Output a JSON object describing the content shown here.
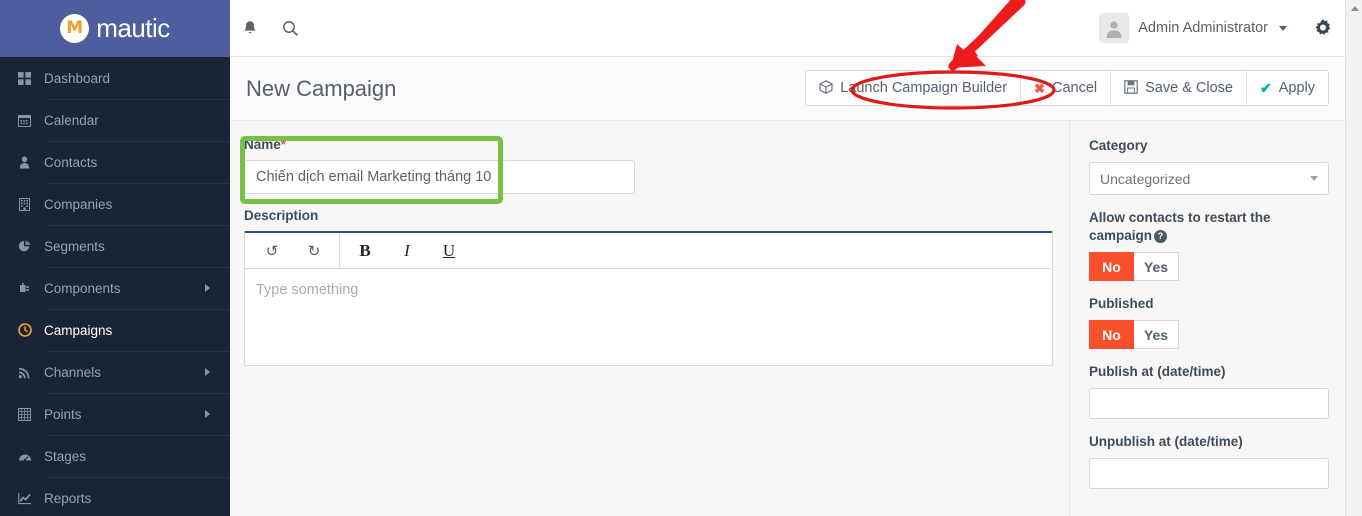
{
  "brand": {
    "name": "mautic",
    "logo_letter": "M"
  },
  "sidebar": {
    "items": [
      {
        "label": "Dashboard",
        "icon": "grid-icon",
        "active": false,
        "has_submenu": false
      },
      {
        "label": "Calendar",
        "icon": "calendar-icon",
        "active": false,
        "has_submenu": false
      },
      {
        "label": "Contacts",
        "icon": "user-icon",
        "active": false,
        "has_submenu": false
      },
      {
        "label": "Companies",
        "icon": "building-icon",
        "active": false,
        "has_submenu": false
      },
      {
        "label": "Segments",
        "icon": "pie-chart-icon",
        "active": false,
        "has_submenu": false
      },
      {
        "label": "Components",
        "icon": "puzzle-icon",
        "active": false,
        "has_submenu": true
      },
      {
        "label": "Campaigns",
        "icon": "clock-icon",
        "active": true,
        "has_submenu": false
      },
      {
        "label": "Channels",
        "icon": "rss-icon",
        "active": false,
        "has_submenu": true
      },
      {
        "label": "Points",
        "icon": "table-icon",
        "active": false,
        "has_submenu": true
      },
      {
        "label": "Stages",
        "icon": "gauge-icon",
        "active": false,
        "has_submenu": false
      },
      {
        "label": "Reports",
        "icon": "line-chart-icon",
        "active": false,
        "has_submenu": false
      }
    ]
  },
  "topbar": {
    "notifications_icon": "bell-icon",
    "search_icon": "search-icon",
    "user_name": "Admin Administrator",
    "avatar_icon": "avatar-icon",
    "settings_icon": "gear-icon"
  },
  "header": {
    "title": "New Campaign",
    "buttons": [
      {
        "label": "Launch Campaign Builder",
        "icon": "cube-icon",
        "icon_class": "grey"
      },
      {
        "label": "Cancel",
        "icon": "✖",
        "icon_class": "red"
      },
      {
        "label": "Save & Close",
        "icon": "save-icon",
        "icon_class": "grey"
      },
      {
        "label": "Apply",
        "icon": "✔",
        "icon_class": "teal"
      }
    ]
  },
  "form": {
    "name_label": "Name",
    "name_required_mark": "*",
    "name_value": "Chiến dịch email Marketing tháng 10",
    "name_placeholder": "",
    "description_label": "Description",
    "description_placeholder": "Type something",
    "editor_buttons": [
      {
        "name": "undo",
        "glyph": "↺"
      },
      {
        "name": "redo",
        "glyph": "↻"
      },
      {
        "name": "bold",
        "glyph": "B"
      },
      {
        "name": "italic",
        "glyph": "I"
      },
      {
        "name": "underline",
        "glyph": "U"
      }
    ]
  },
  "right_panel": {
    "category_label": "Category",
    "category_value": "Uncategorized",
    "restart_label": "Allow contacts to restart the campaign",
    "restart_help_glyph": "?",
    "restart_no": "No",
    "restart_yes": "Yes",
    "restart_selected": "No",
    "published_label": "Published",
    "published_no": "No",
    "published_yes": "Yes",
    "published_selected": "No",
    "publish_at_label": "Publish at (date/time)",
    "publish_at_value": "",
    "unpublish_at_label": "Unpublish at (date/time)",
    "unpublish_at_value": ""
  },
  "annotations": {
    "arrow_color": "#ee1b1b",
    "ellipse_color": "#e01919",
    "highlight_color": "#76c043",
    "highlight_target": "name-field",
    "arrow_target": "launch-campaign-builder-button"
  },
  "colors": {
    "brand_blue": "#4e5e9e",
    "sidebar_dark": "#1b2437",
    "accent_orange": "#f5a623",
    "toggle_on_red": "#f8502a",
    "editor_top_border": "#3b4a87"
  }
}
